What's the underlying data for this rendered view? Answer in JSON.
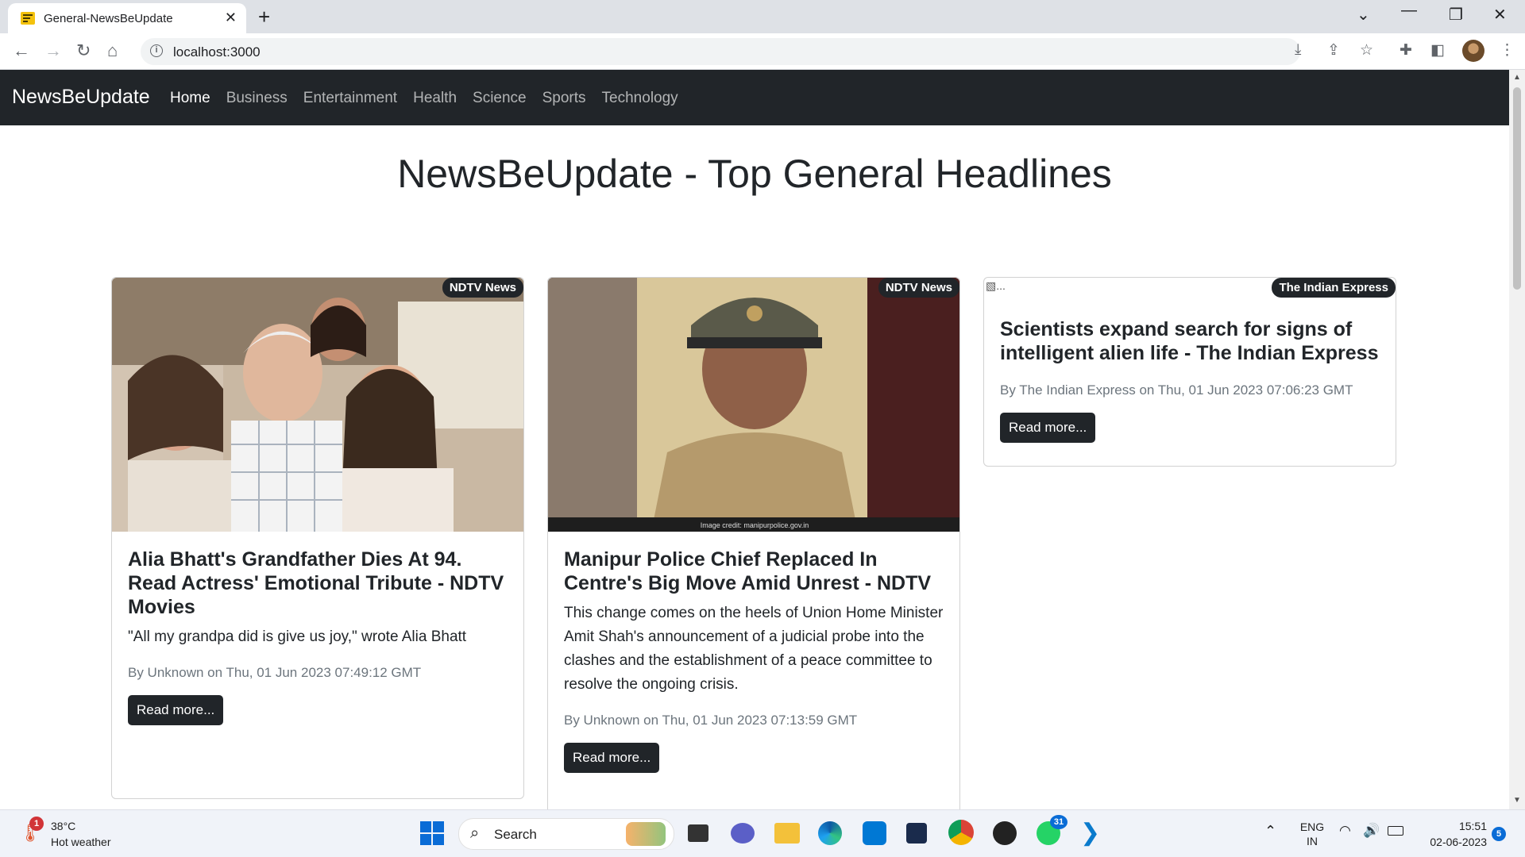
{
  "browser": {
    "tab_title": "General-NewsBeUpdate",
    "url": "localhost:3000"
  },
  "navbar": {
    "brand": "NewsBeUpdate",
    "links": [
      "Home",
      "Business",
      "Entertainment",
      "Health",
      "Science",
      "Sports",
      "Technology"
    ],
    "active": "Home"
  },
  "page": {
    "title": "NewsBeUpdate - Top General Headlines"
  },
  "articles": [
    {
      "source": "NDTV News",
      "title": "Alia Bhatt's Grandfather Dies At 94. Read Actress' Emotional Tribute - NDTV Movies",
      "description": "\"All my grandpa did is give us joy,\" wrote Alia Bhatt",
      "meta": "By Unknown on Thu, 01 Jun 2023 07:49:12 GMT",
      "button": "Read more..."
    },
    {
      "source": "NDTV News",
      "title": "Manipur Police Chief Replaced In Centre's Big Move Amid Unrest - NDTV",
      "description": "This change comes on the heels of Union Home Minister Amit Shah's announcement of a judicial probe into the clashes and the establishment of a peace committee to resolve the ongoing crisis.",
      "image_caption": "Image credit: manipurpolice.gov.in",
      "meta": "By Unknown on Thu, 01 Jun 2023 07:13:59 GMT",
      "button": "Read more..."
    },
    {
      "source": "The Indian Express",
      "image_alt": "...",
      "title": "Scientists expand search for signs of intelligent alien life - The Indian Express",
      "meta": "By The Indian Express on Thu, 01 Jun 2023 07:06:23 GMT",
      "button": "Read more..."
    }
  ],
  "taskbar": {
    "weather_temp": "38°C",
    "weather_desc": "Hot weather",
    "weather_badge": "1",
    "search_label": "Search",
    "whatsapp_badge": "31",
    "lang_top": "ENG",
    "lang_bottom": "IN",
    "time": "15:51",
    "date": "02-06-2023",
    "notif_count": "5"
  },
  "colors": {
    "navbar_bg": "#212529",
    "badge_bg": "#212529",
    "button_bg": "#212529"
  }
}
